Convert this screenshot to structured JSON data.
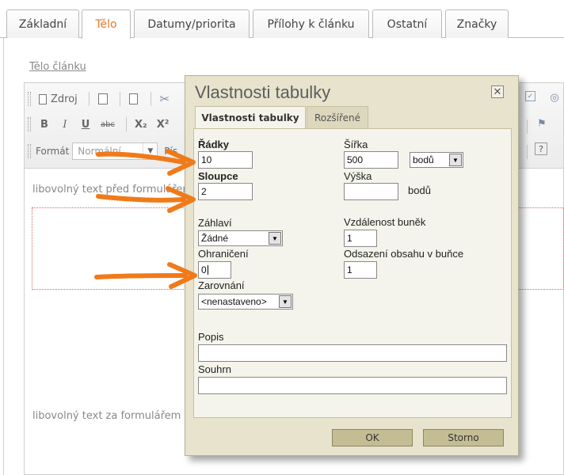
{
  "tabs": [
    {
      "label": "Základní"
    },
    {
      "label": "Tělo"
    },
    {
      "label": "Datumy/priorita"
    },
    {
      "label": "Přílohy k článku"
    },
    {
      "label": "Ostatní"
    },
    {
      "label": "Značky"
    }
  ],
  "editor": {
    "label": "Tělo článku",
    "toolbar": {
      "source_label": "Zdroj",
      "format_label": "Formát",
      "format_value": "Normální",
      "font_label": "Pís",
      "bold_label": "B",
      "italic_label": "I",
      "underline_label": "U",
      "strike_label": "abc",
      "subscript_label": "X₂",
      "superscript_label": "X²",
      "help_label": "?"
    },
    "text_before": "libovolný text před formulářem",
    "text_after": "libovolný text za formulářem"
  },
  "dialog": {
    "title": "Vlastnosti tabulky",
    "tabs": [
      {
        "label": "Vlastnosti tabulky"
      },
      {
        "label": "Rozšířené"
      }
    ],
    "rows": {
      "label": "Řádky",
      "value": "10"
    },
    "columns": {
      "label": "Sloupce",
      "value": "2"
    },
    "width": {
      "label": "Šířka",
      "value": "500",
      "unit": "bodů"
    },
    "height": {
      "label": "Výška",
      "value": "",
      "unit": "bodů"
    },
    "header": {
      "label": "Záhlaví",
      "value": "Žádné"
    },
    "border": {
      "label": "Ohraničení",
      "value": "0"
    },
    "align": {
      "label": "Zarovnání",
      "value": "<nenastaveno>"
    },
    "cell_spacing": {
      "label": "Vzdálenost buněk",
      "value": "1"
    },
    "cell_padding": {
      "label": "Odsazení obsahu v buňce",
      "value": "1"
    },
    "caption": {
      "label": "Popis",
      "value": ""
    },
    "summary": {
      "label": "Souhrn",
      "value": ""
    },
    "ok_label": "OK",
    "cancel_label": "Storno"
  },
  "colors": {
    "accent_tab": "#e07a2a",
    "dialog_bg": "#e7e3cd",
    "button_bg": "#c4bd94",
    "arrow": "#f07a1a"
  }
}
